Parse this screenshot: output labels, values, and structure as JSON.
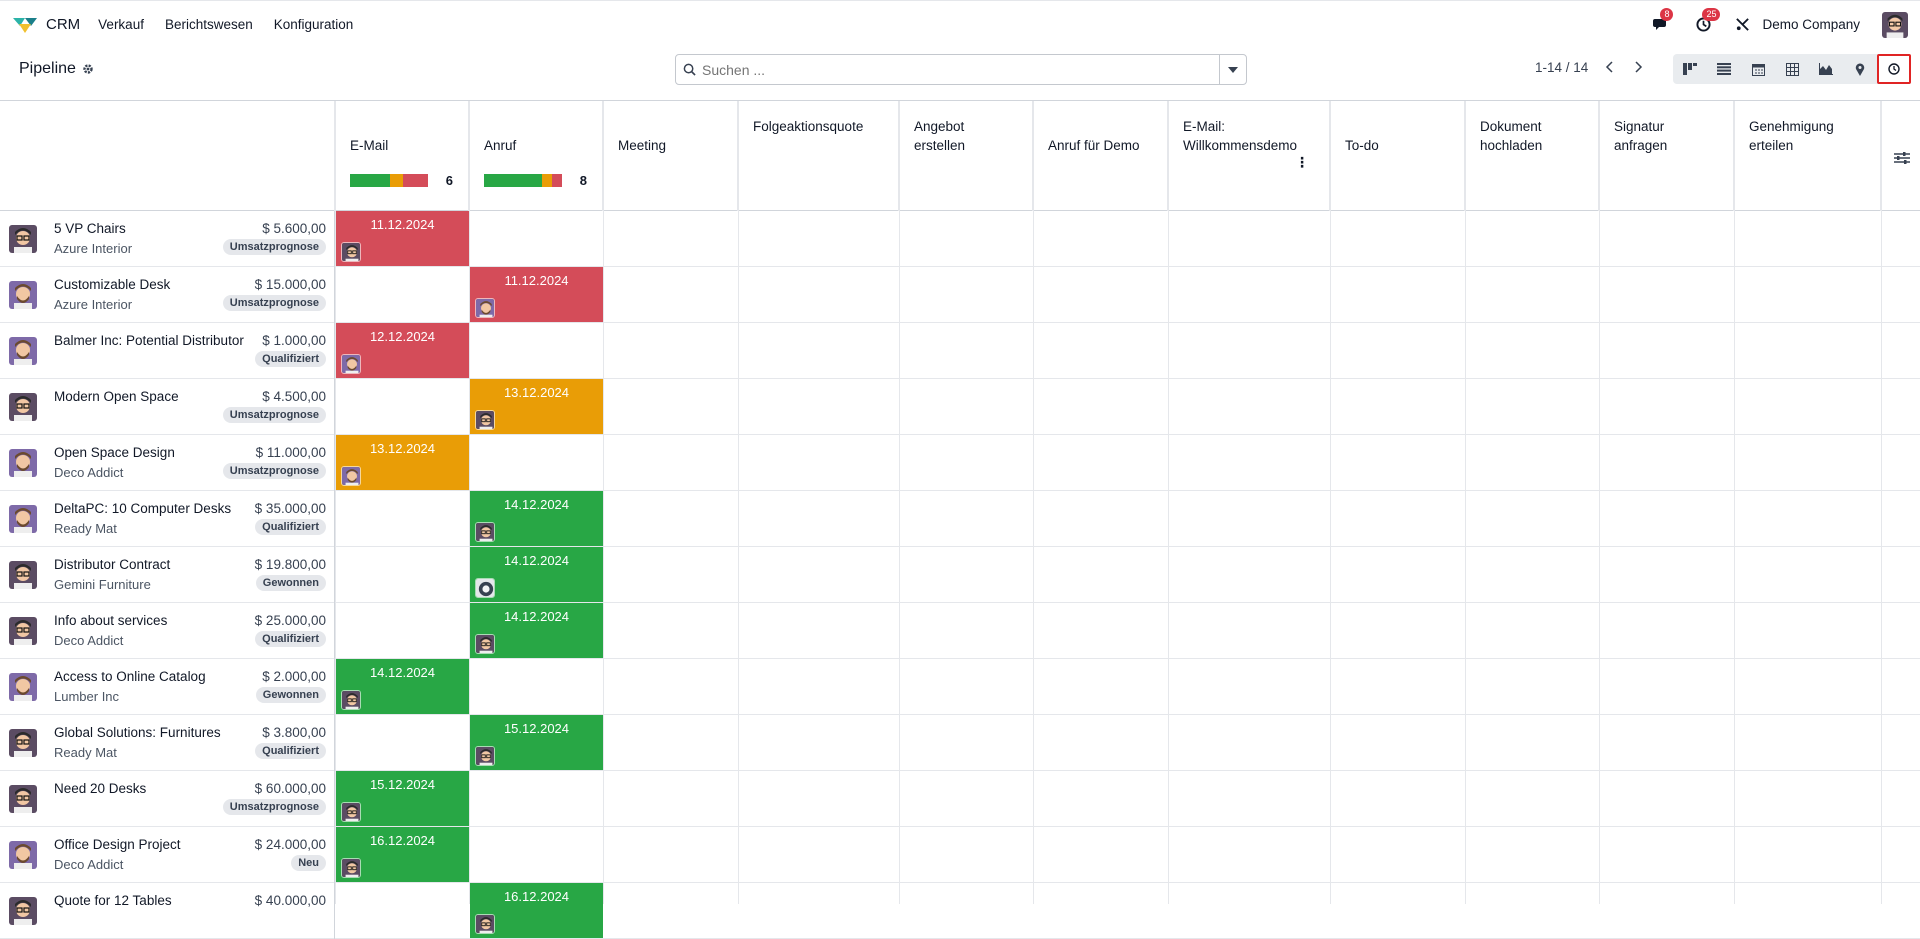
{
  "navbar": {
    "app_name": "CRM",
    "menu": [
      "Verkauf",
      "Berichtswesen",
      "Konfiguration"
    ],
    "messages_count": "8",
    "activities_count": "25",
    "company": "Demo Company"
  },
  "control": {
    "title": "Pipeline",
    "search_placeholder": "Suchen ...",
    "pager": "1-14 / 14"
  },
  "columns": [
    {
      "label": "E-Mail",
      "count": "6"
    },
    {
      "label": "Anruf",
      "count": "8"
    },
    {
      "label": "Meeting"
    },
    {
      "label": "Folgeaktionsquote"
    },
    {
      "label": "Angebot erstellen"
    },
    {
      "label": "Anruf für Demo"
    },
    {
      "label": "E-Mail: Willkommensdemo"
    },
    {
      "label": "To-do"
    },
    {
      "label": "Dokument hochladen"
    },
    {
      "label": "Signatur anfragen"
    },
    {
      "label": "Genehmigung erteilen"
    }
  ],
  "colors": {
    "overdue": "#d44c59",
    "today": "#e99d06",
    "planned": "#28a745"
  },
  "rows": [
    {
      "name": "5 VP Chairs",
      "partner": "Azure Interior",
      "amount": "$ 5.600,00",
      "tag": "Umsatzprognose",
      "col": 0,
      "date": "11.12.2024",
      "state": "red",
      "av": "a"
    },
    {
      "name": "Customizable Desk",
      "partner": "Azure Interior",
      "amount": "$ 15.000,00",
      "tag": "Umsatzprognose",
      "col": 1,
      "date": "11.12.2024",
      "state": "red",
      "av": "b"
    },
    {
      "name": "Balmer Inc: Potential Distributor",
      "partner": "",
      "amount": "$ 1.000,00",
      "tag": "Qualifiziert",
      "col": 0,
      "date": "12.12.2024",
      "state": "red",
      "av": "b"
    },
    {
      "name": "Modern Open Space",
      "partner": "",
      "amount": "$ 4.500,00",
      "tag": "Umsatzprognose",
      "col": 1,
      "date": "13.12.2024",
      "state": "orange",
      "av": "a"
    },
    {
      "name": "Open Space Design",
      "partner": "Deco Addict",
      "amount": "$ 11.000,00",
      "tag": "Umsatzprognose",
      "col": 0,
      "date": "13.12.2024",
      "state": "orange",
      "av": "b"
    },
    {
      "name": "DeltaPC: 10 Computer Desks",
      "partner": "Ready Mat",
      "amount": "$ 35.000,00",
      "tag": "Qualifiziert",
      "col": 1,
      "date": "14.12.2024",
      "state": "green",
      "av": "a"
    },
    {
      "name": "Distributor Contract",
      "partner": "Gemini Furniture",
      "amount": "$ 19.800,00",
      "tag": "Gewonnen",
      "col": 1,
      "date": "14.12.2024",
      "state": "green",
      "av": "c"
    },
    {
      "name": "Info about services",
      "partner": "Deco Addict",
      "amount": "$ 25.000,00",
      "tag": "Qualifiziert",
      "col": 1,
      "date": "14.12.2024",
      "state": "green",
      "av": "a"
    },
    {
      "name": "Access to Online Catalog",
      "partner": "Lumber Inc",
      "amount": "$ 2.000,00",
      "tag": "Gewonnen",
      "col": 0,
      "date": "14.12.2024",
      "state": "green",
      "av": "a"
    },
    {
      "name": "Global Solutions: Furnitures",
      "partner": "Ready Mat",
      "amount": "$ 3.800,00",
      "tag": "Qualifiziert",
      "col": 1,
      "date": "15.12.2024",
      "state": "green",
      "av": "a"
    },
    {
      "name": "Need 20 Desks",
      "partner": "",
      "amount": "$ 60.000,00",
      "tag": "Umsatzprognose",
      "col": 0,
      "date": "15.12.2024",
      "state": "green",
      "av": "a"
    },
    {
      "name": "Office Design Project",
      "partner": "Deco Addict",
      "amount": "$ 24.000,00",
      "tag": "Neu",
      "col": 0,
      "date": "16.12.2024",
      "state": "green",
      "av": "a"
    },
    {
      "name": "Quote for 12 Tables",
      "partner": "",
      "amount": "$ 40.000,00",
      "tag": "",
      "col": 1,
      "date": "16.12.2024",
      "state": "green",
      "av": "a"
    }
  ],
  "lead_avatars": [
    "a",
    "b",
    "b",
    "a",
    "b",
    "b",
    "a",
    "a",
    "b",
    "a",
    "a",
    "b",
    "a"
  ]
}
